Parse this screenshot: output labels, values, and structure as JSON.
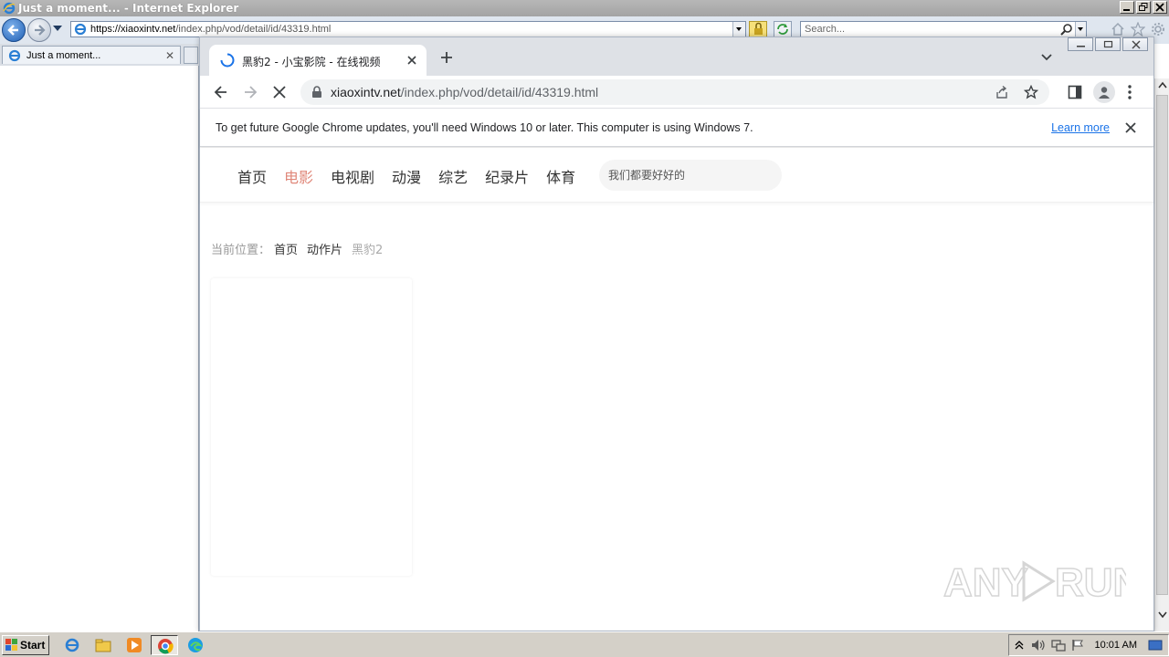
{
  "ie": {
    "title": "Just a moment... - Internet Explorer",
    "url_host": "https://xiaoxintv.net",
    "url_path": "/index.php/vod/detail/id/43319.html",
    "search_placeholder": "Search...",
    "tab_label": "Just a moment...",
    "tab_close": "✕",
    "icons": [
      "ie-logo",
      "back-arrow",
      "forward-arrow",
      "lock",
      "refresh",
      "search",
      "home",
      "star",
      "gear"
    ]
  },
  "chrome": {
    "tab_title": "黑豹2 - 小宝影院 - 在线视频",
    "url_host": "xiaoxintv.net",
    "url_path": "/index.php/vod/detail/id/43319.html",
    "infobar": {
      "message": "To get future Google Chrome updates, you'll need Windows 10 or later. This computer is using Windows 7.",
      "link": "Learn more"
    },
    "loading": true
  },
  "site": {
    "nav": [
      {
        "label": "首页",
        "active": false
      },
      {
        "label": "电影",
        "active": true
      },
      {
        "label": "电视剧",
        "active": false
      },
      {
        "label": "动漫",
        "active": false
      },
      {
        "label": "综艺",
        "active": false
      },
      {
        "label": "纪录片",
        "active": false
      },
      {
        "label": "体育",
        "active": false
      }
    ],
    "search_placeholder": "我们都要好好的",
    "breadcrumb": {
      "prefix": "当前位置：",
      "links": [
        "首页",
        "动作片"
      ],
      "current": "黑豹2"
    },
    "accent_color": "#e0887a"
  },
  "watermark": "ANY RUN",
  "taskbar": {
    "start_label": "Start",
    "clock": "10:01 AM"
  }
}
